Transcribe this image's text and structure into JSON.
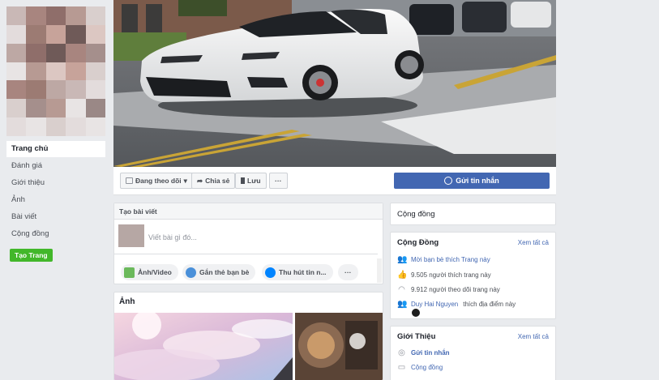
{
  "sidebar": {
    "items": [
      {
        "label": "Trang chủ",
        "active": true
      },
      {
        "label": "Đánh giá"
      },
      {
        "label": "Giới thiệu"
      },
      {
        "label": "Ảnh"
      },
      {
        "label": "Bài viết"
      },
      {
        "label": "Cộng đồng"
      }
    ],
    "create_page_label": "Tạo Trang"
  },
  "actions": {
    "following_label": "Đang theo dõi",
    "share_label": "Chia sẻ",
    "save_label": "Lưu",
    "more_label": "···",
    "message_label": "Gửi tin nhắn"
  },
  "composer": {
    "header": "Tạo bài viết",
    "placeholder": "Viết bài gì đó...",
    "photo_video_label": "Ảnh/Video",
    "tag_friends_label": "Gắn thẻ bạn bè",
    "messenger_label": "Thu hút tin n...",
    "more_label": "···"
  },
  "photos": {
    "title": "Ảnh"
  },
  "community_tab": {
    "label": "Cộng đồng"
  },
  "community": {
    "title": "Cộng Đồng",
    "see_all": "Xem tất cả",
    "invite_label": "Mời bạn bè thích Trang này",
    "likes_label": "9.505 người thích trang này",
    "followers_label": "9.912 người theo dõi trang này",
    "checkin_name": "Duy Hai Nguyen",
    "checkin_text": "thích địa điểm này"
  },
  "about": {
    "title": "Giới Thiệu",
    "see_all": "Xem tất cả",
    "message_label": "Gửi tin nhắn",
    "community_label": "Cộng đồng"
  },
  "colors": {
    "brand_blue": "#4267b2",
    "create_green": "#42b72a",
    "background": "#e9ebee"
  }
}
